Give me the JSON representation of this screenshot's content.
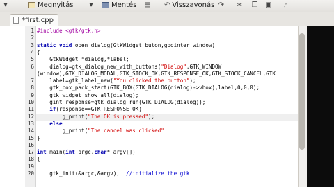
{
  "toolbar": {
    "open_label": "Megnyitás",
    "save_label": "Mentés",
    "undo_label": "Visszavonás"
  },
  "tab": {
    "label": "*first.cpp"
  },
  "lines": [
    {
      "n": "1",
      "parts": [
        [
          "pp",
          "#include <gtk/gtk.h>"
        ]
      ]
    },
    {
      "n": "2",
      "parts": [
        [
          "",
          ""
        ]
      ]
    },
    {
      "n": "3",
      "parts": [
        [
          "kw",
          "static void"
        ],
        [
          "",
          " open_dialog(GtkWidget buton,gpointer window)"
        ]
      ]
    },
    {
      "n": "4",
      "parts": [
        [
          "",
          "{"
        ]
      ]
    },
    {
      "n": "5",
      "parts": [
        [
          "",
          "    GtkWidget *dialog,*label;"
        ]
      ]
    },
    {
      "n": "6",
      "parts": [
        [
          "",
          "    dialog=gtk_dialog_new_with_buttons("
        ],
        [
          "str",
          "\"Dialog\""
        ],
        [
          "",
          ",GTK_WINDOW"
        ]
      ]
    },
    {
      "n": "",
      "parts": [
        [
          "",
          "(window),GTK_DIALOG_MODAL,GTK_STOCK_OK,GTK_RESPONSE_OK,GTK_STOCK_CANCEL,GTK"
        ]
      ]
    },
    {
      "n": "7",
      "parts": [
        [
          "",
          "    label=gtk_label_new("
        ],
        [
          "str",
          "\"You clicked the button\""
        ],
        [
          "",
          ");"
        ]
      ]
    },
    {
      "n": "8",
      "parts": [
        [
          "",
          "    gtk_box_pack_start(GTK_BOX(GTK_DIALOG(dialog)->vbox),label,0,0,0);"
        ]
      ]
    },
    {
      "n": "9",
      "parts": [
        [
          "",
          "    gtk_widget_show_all(dialog);"
        ]
      ]
    },
    {
      "n": "10",
      "parts": [
        [
          "",
          "    gint response=gtk_dialog_run(GTK_DIALOG(dialog));"
        ]
      ]
    },
    {
      "n": "11",
      "parts": [
        [
          "",
          "    "
        ],
        [
          "kw",
          "if"
        ],
        [
          "",
          "(response==GTK_RESPONSE_OK)"
        ]
      ]
    },
    {
      "n": "12",
      "cur": true,
      "parts": [
        [
          "",
          "        g_print("
        ],
        [
          "str",
          "\"The OK is pressed\""
        ],
        [
          "",
          ");"
        ]
      ]
    },
    {
      "n": "13",
      "parts": [
        [
          "",
          "    "
        ],
        [
          "kw",
          "else"
        ]
      ]
    },
    {
      "n": "14",
      "parts": [
        [
          "",
          "        g_print("
        ],
        [
          "str",
          "\"The cancel was clicked\""
        ]
      ]
    },
    {
      "n": "15",
      "parts": [
        [
          "",
          "}"
        ]
      ]
    },
    {
      "n": "16",
      "parts": [
        [
          "",
          ""
        ]
      ]
    },
    {
      "n": "17",
      "parts": [
        [
          "kw",
          "int"
        ],
        [
          "",
          " main("
        ],
        [
          "kw",
          "int"
        ],
        [
          "",
          " argc,"
        ],
        [
          "kw",
          "char"
        ],
        [
          "",
          "* argv[])"
        ]
      ]
    },
    {
      "n": "18",
      "parts": [
        [
          "",
          "{"
        ]
      ]
    },
    {
      "n": "19",
      "parts": [
        [
          "",
          ""
        ]
      ]
    },
    {
      "n": "20",
      "parts": [
        [
          "",
          "    gtk_init(&argc,&argv);  "
        ],
        [
          "cm",
          "//initialize the gtk"
        ]
      ]
    }
  ]
}
